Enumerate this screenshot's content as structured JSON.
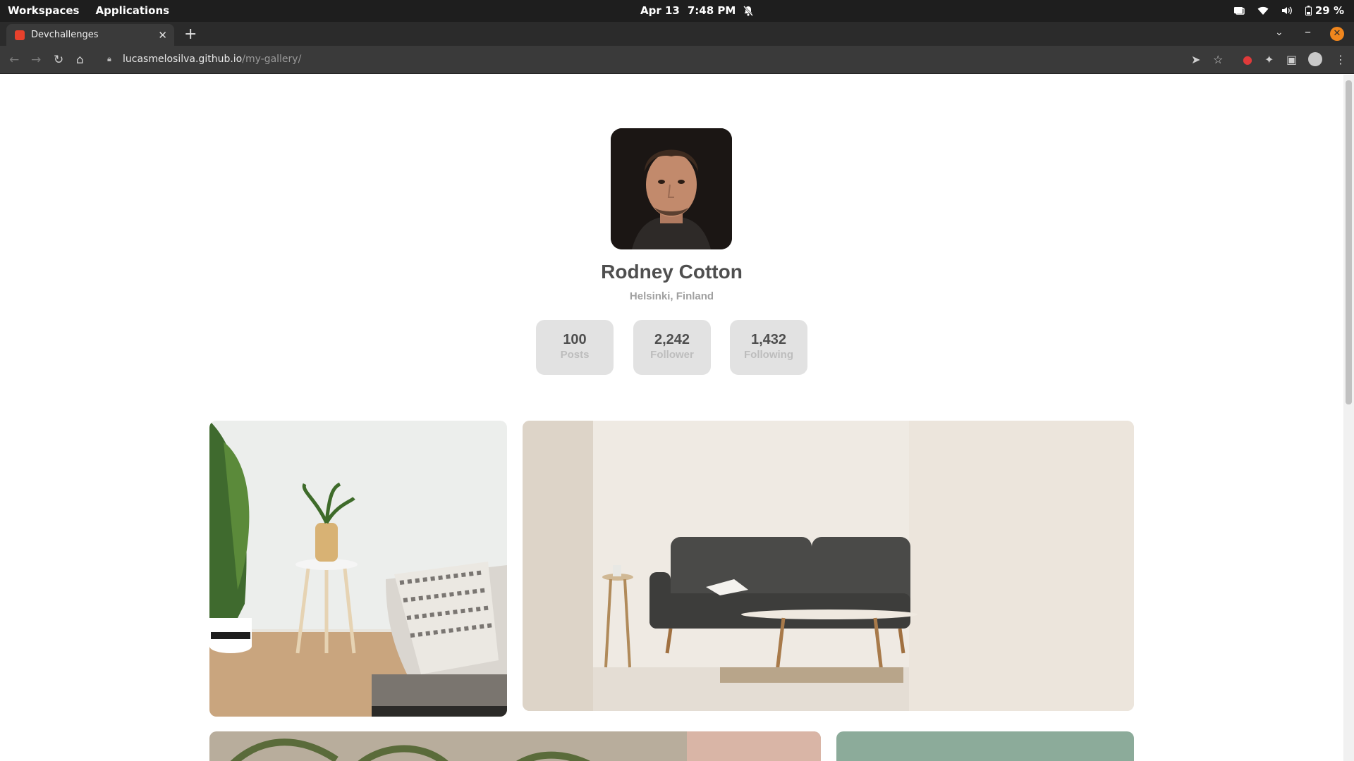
{
  "os": {
    "workspaces_label": "Workspaces",
    "applications_label": "Applications",
    "date": "Apr 13",
    "time": "7:48 PM",
    "battery": "29 %"
  },
  "browser": {
    "tab_title": "Devchallenges",
    "url_host": "lucasmelosilva.github.io",
    "url_path": "/my-gallery/"
  },
  "profile": {
    "name": "Rodney Cotton",
    "location": "Helsinki, Finland",
    "stats": [
      {
        "value": "100",
        "label": "Posts"
      },
      {
        "value": "2,242",
        "label": "Follower"
      },
      {
        "value": "1,432",
        "label": "Following"
      }
    ]
  },
  "colors": {
    "accent_close": "#f0861d",
    "text_primary": "#4f4f4f",
    "text_secondary": "#a0a0a0",
    "stat_bg": "#e2e2e2"
  }
}
